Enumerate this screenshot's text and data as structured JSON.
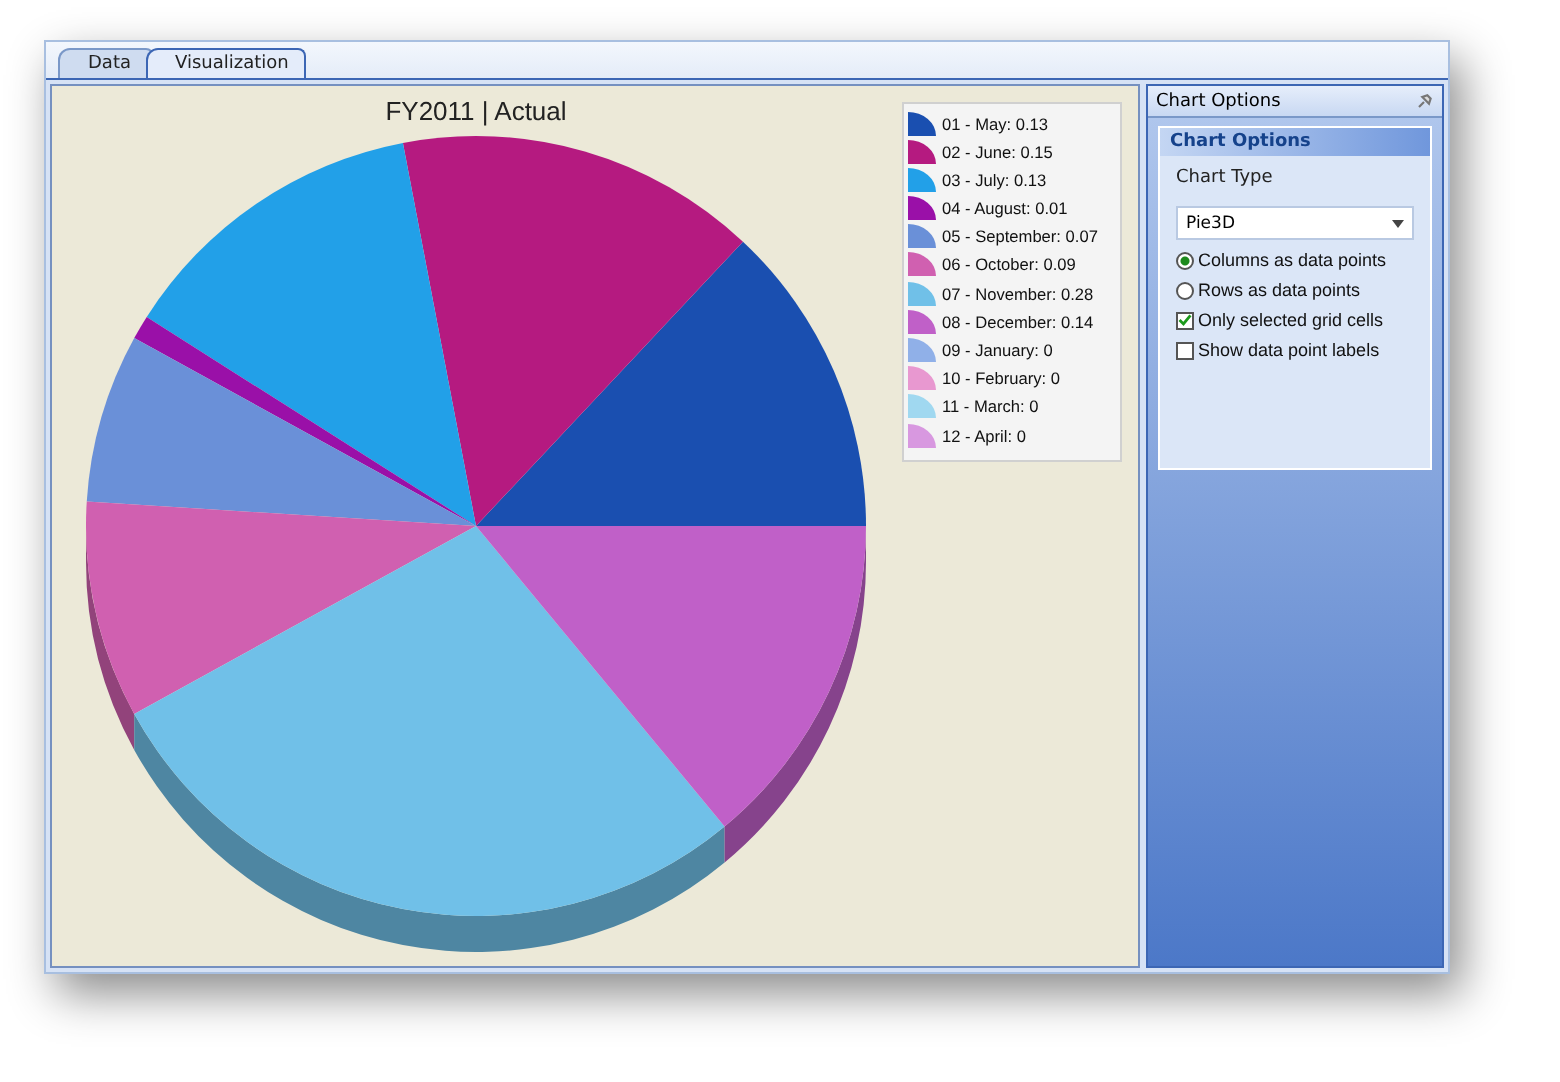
{
  "tabs": [
    {
      "label": "Data",
      "selected": false
    },
    {
      "label": "Visualization",
      "selected": true
    }
  ],
  "chart": {
    "chart_data": {
      "type": "pie",
      "title": "FY2011 | Actual",
      "categories": [
        "01 - May: 0.13",
        "02 - June: 0.15",
        "03 - July: 0.13",
        "04 - August: 0.01",
        "05 - September: 0.07",
        "06 - October: 0.09",
        "07 - November: 0.28",
        "08 - December: 0.14",
        "09 - January: 0",
        "10 - February: 0",
        "11 - March: 0",
        "12 - April: 0"
      ],
      "values": [
        0.13,
        0.15,
        0.13,
        0.01,
        0.07,
        0.09,
        0.28,
        0.14,
        0,
        0,
        0,
        0
      ],
      "colors": [
        "#1a4fb0",
        "#b51a80",
        "#22a0e8",
        "#9a10a8",
        "#6a90d8",
        "#d060b0",
        "#70c0e8",
        "#c060c8",
        "#90b0e8",
        "#e898d0",
        "#a0d8f0",
        "#d898e0"
      ]
    }
  },
  "options_pane": {
    "title": "Chart Options",
    "section_title": "Chart Options",
    "chart_type": {
      "label": "Chart Type",
      "value": "Pie3D"
    },
    "options": [
      {
        "kind": "radio",
        "label": "Columns as data points",
        "selected": true
      },
      {
        "kind": "radio",
        "label": "Rows as data points",
        "selected": false
      },
      {
        "kind": "checkbox",
        "label": "Only selected grid cells",
        "checked": true
      },
      {
        "kind": "checkbox",
        "label": "Show data point labels",
        "checked": false
      }
    ]
  }
}
